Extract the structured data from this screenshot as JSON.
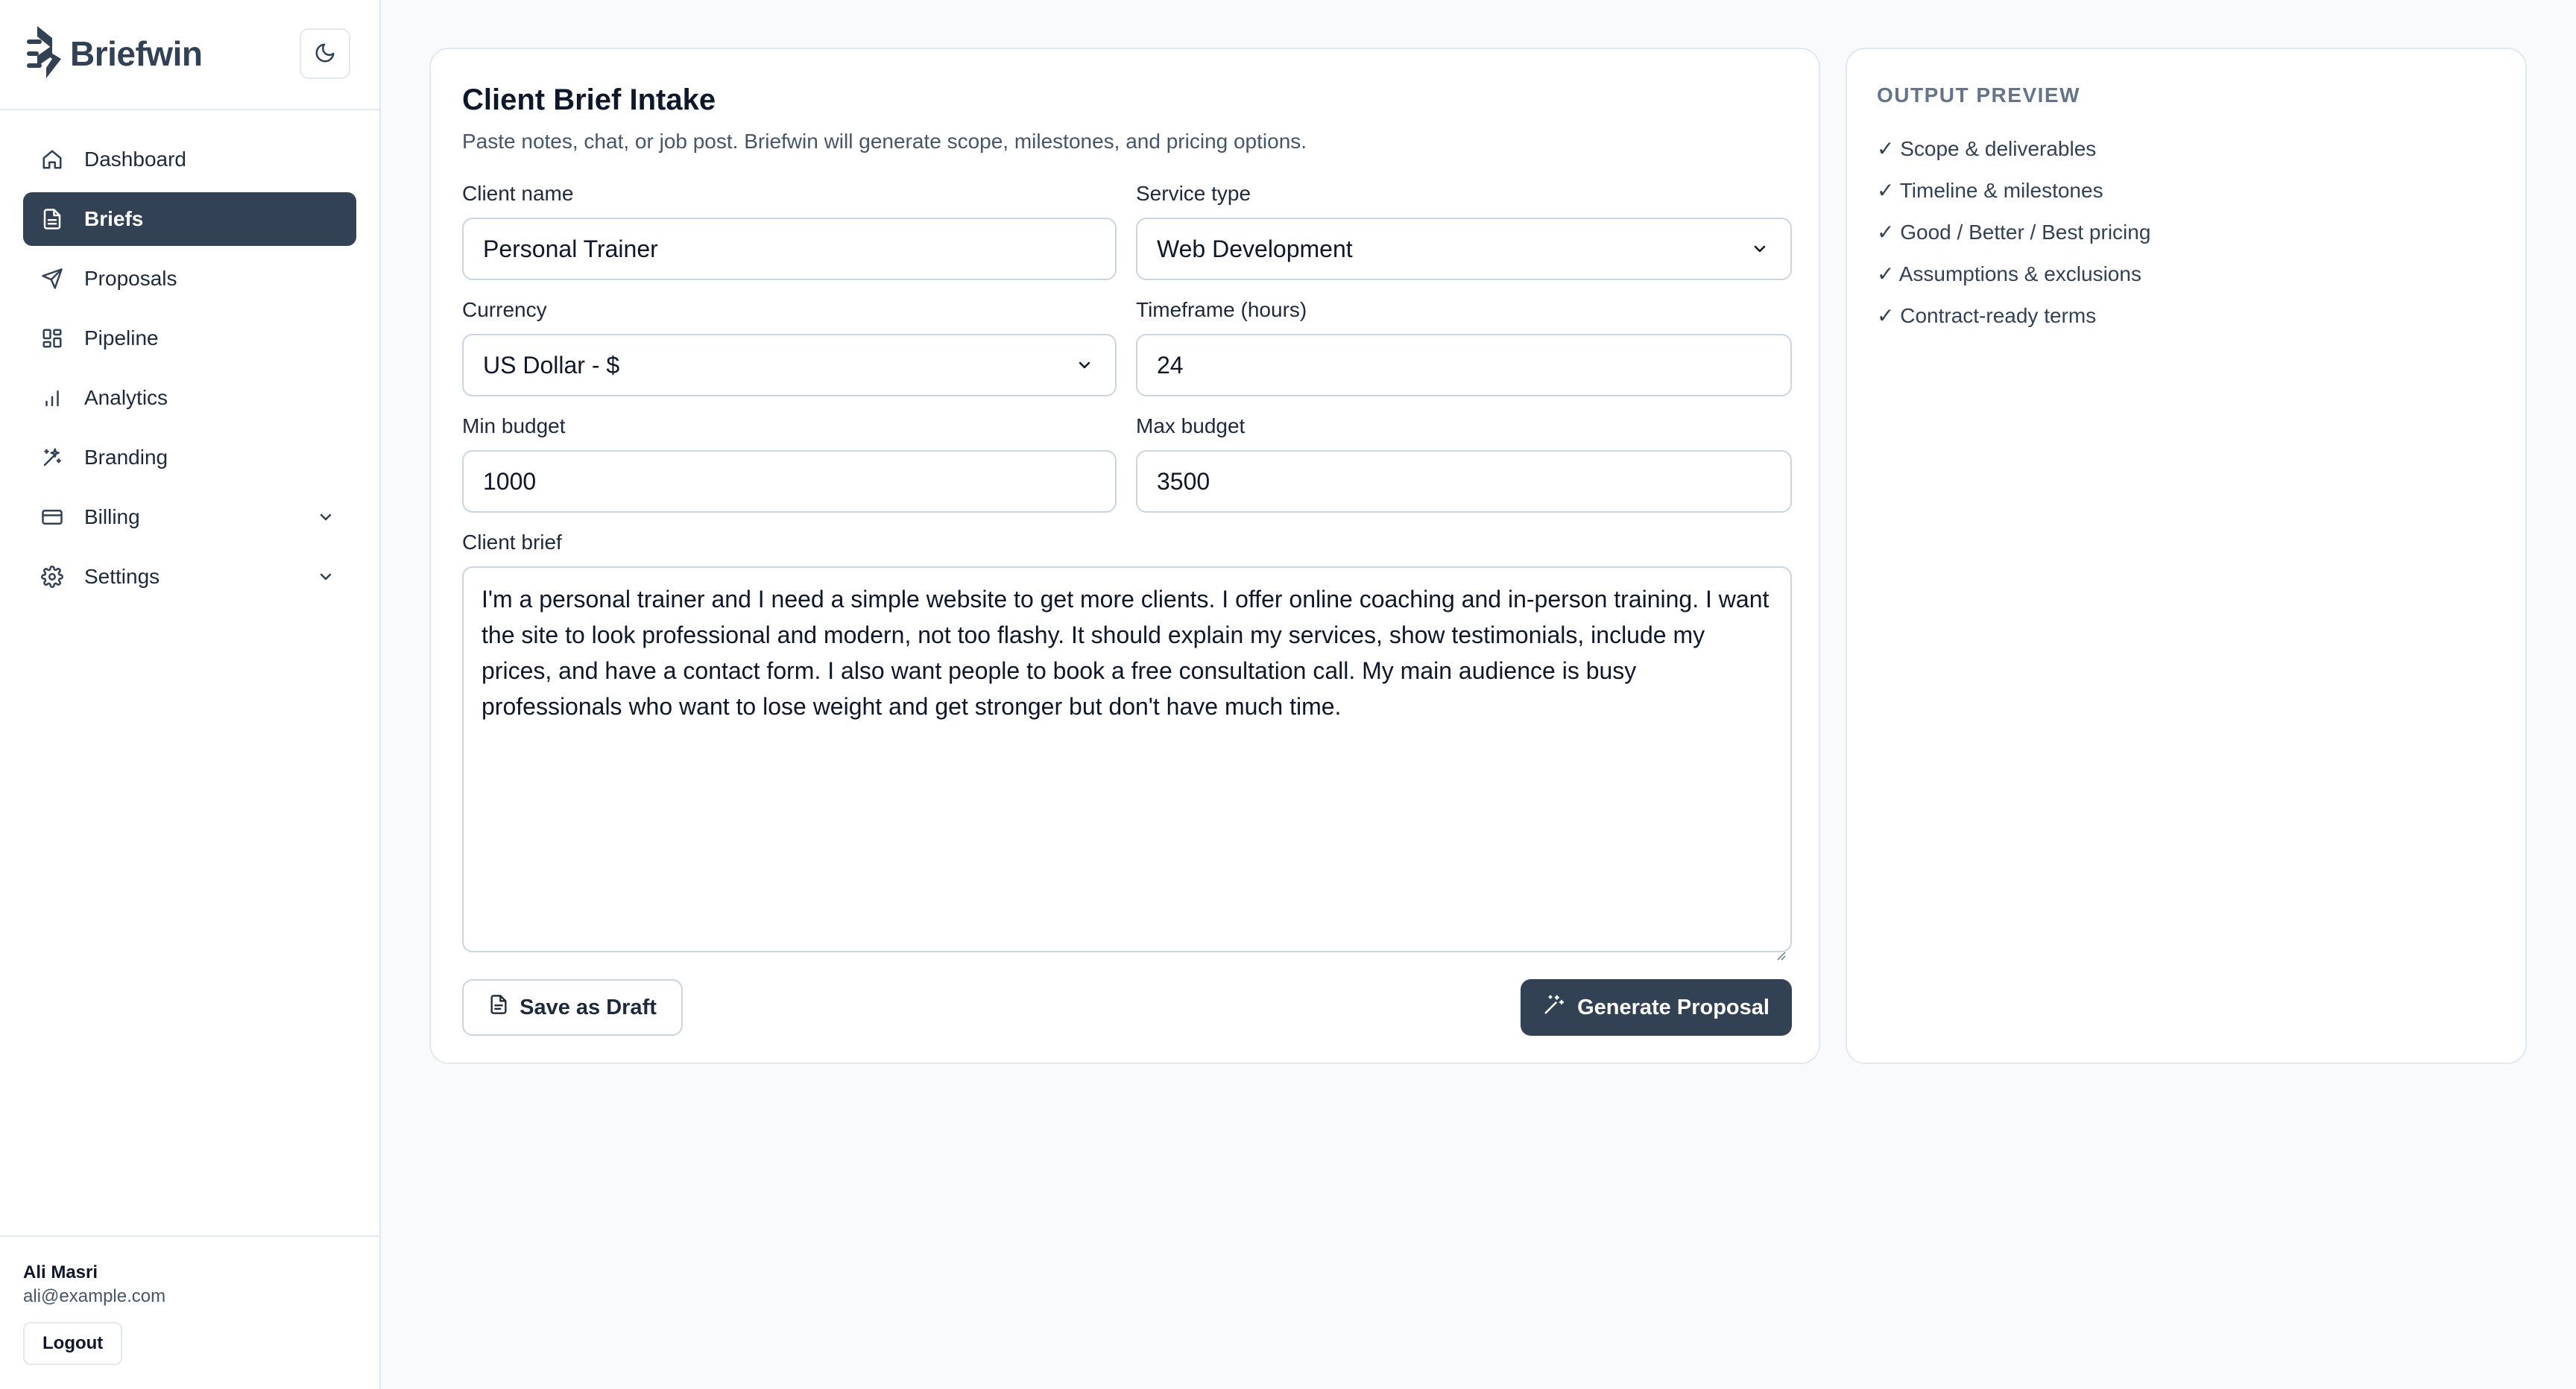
{
  "brand": {
    "name": "Briefwin"
  },
  "colors": {
    "accent": "#334155",
    "border": "#e2e8f0",
    "background": "#f8fafc"
  },
  "sidebar": {
    "theme_toggle_icon": "moon-icon",
    "items": [
      {
        "label": "Dashboard",
        "icon": "home-icon",
        "active": false
      },
      {
        "label": "Briefs",
        "icon": "document-icon",
        "active": true
      },
      {
        "label": "Proposals",
        "icon": "send-icon",
        "active": false
      },
      {
        "label": "Pipeline",
        "icon": "grid-icon",
        "active": false
      },
      {
        "label": "Analytics",
        "icon": "bar-chart-icon",
        "active": false
      },
      {
        "label": "Branding",
        "icon": "sparkles-icon",
        "active": false
      },
      {
        "label": "Billing",
        "icon": "credit-card-icon",
        "active": false,
        "expandable": true
      },
      {
        "label": "Settings",
        "icon": "gear-icon",
        "active": false,
        "expandable": true
      }
    ]
  },
  "user": {
    "name": "Ali Masri",
    "email": "ali@example.com",
    "logout_label": "Logout"
  },
  "form": {
    "title": "Client Brief Intake",
    "subtitle": "Paste notes, chat, or job post. Briefwin will generate scope, milestones, and pricing options.",
    "client_name": {
      "label": "Client name",
      "value": "Personal Trainer"
    },
    "service_type": {
      "label": "Service type",
      "value": "Web Development"
    },
    "currency": {
      "label": "Currency",
      "value": "US Dollar - $"
    },
    "timeframe": {
      "label": "Timeframe (hours)",
      "value": "24"
    },
    "min_budget": {
      "label": "Min budget",
      "value": "1000"
    },
    "max_budget": {
      "label": "Max budget",
      "value": "3500"
    },
    "client_brief": {
      "label": "Client brief",
      "value": "I'm a personal trainer and I need a simple website to get more clients. I offer online coaching and in-person training. I want the site to look professional and modern, not too flashy. It should explain my services, show testimonials, include my prices, and have a contact form. I also want people to book a free consultation call. My main audience is busy professionals who want to lose weight and get stronger but don't have much time."
    },
    "save_draft_label": "Save as Draft",
    "generate_label": "Generate Proposal"
  },
  "preview": {
    "heading": "OUTPUT PREVIEW",
    "items": [
      "✓ Scope & deliverables",
      "✓ Timeline & milestones",
      "✓ Good / Better / Best pricing",
      "✓ Assumptions & exclusions",
      "✓ Contract-ready terms"
    ]
  }
}
